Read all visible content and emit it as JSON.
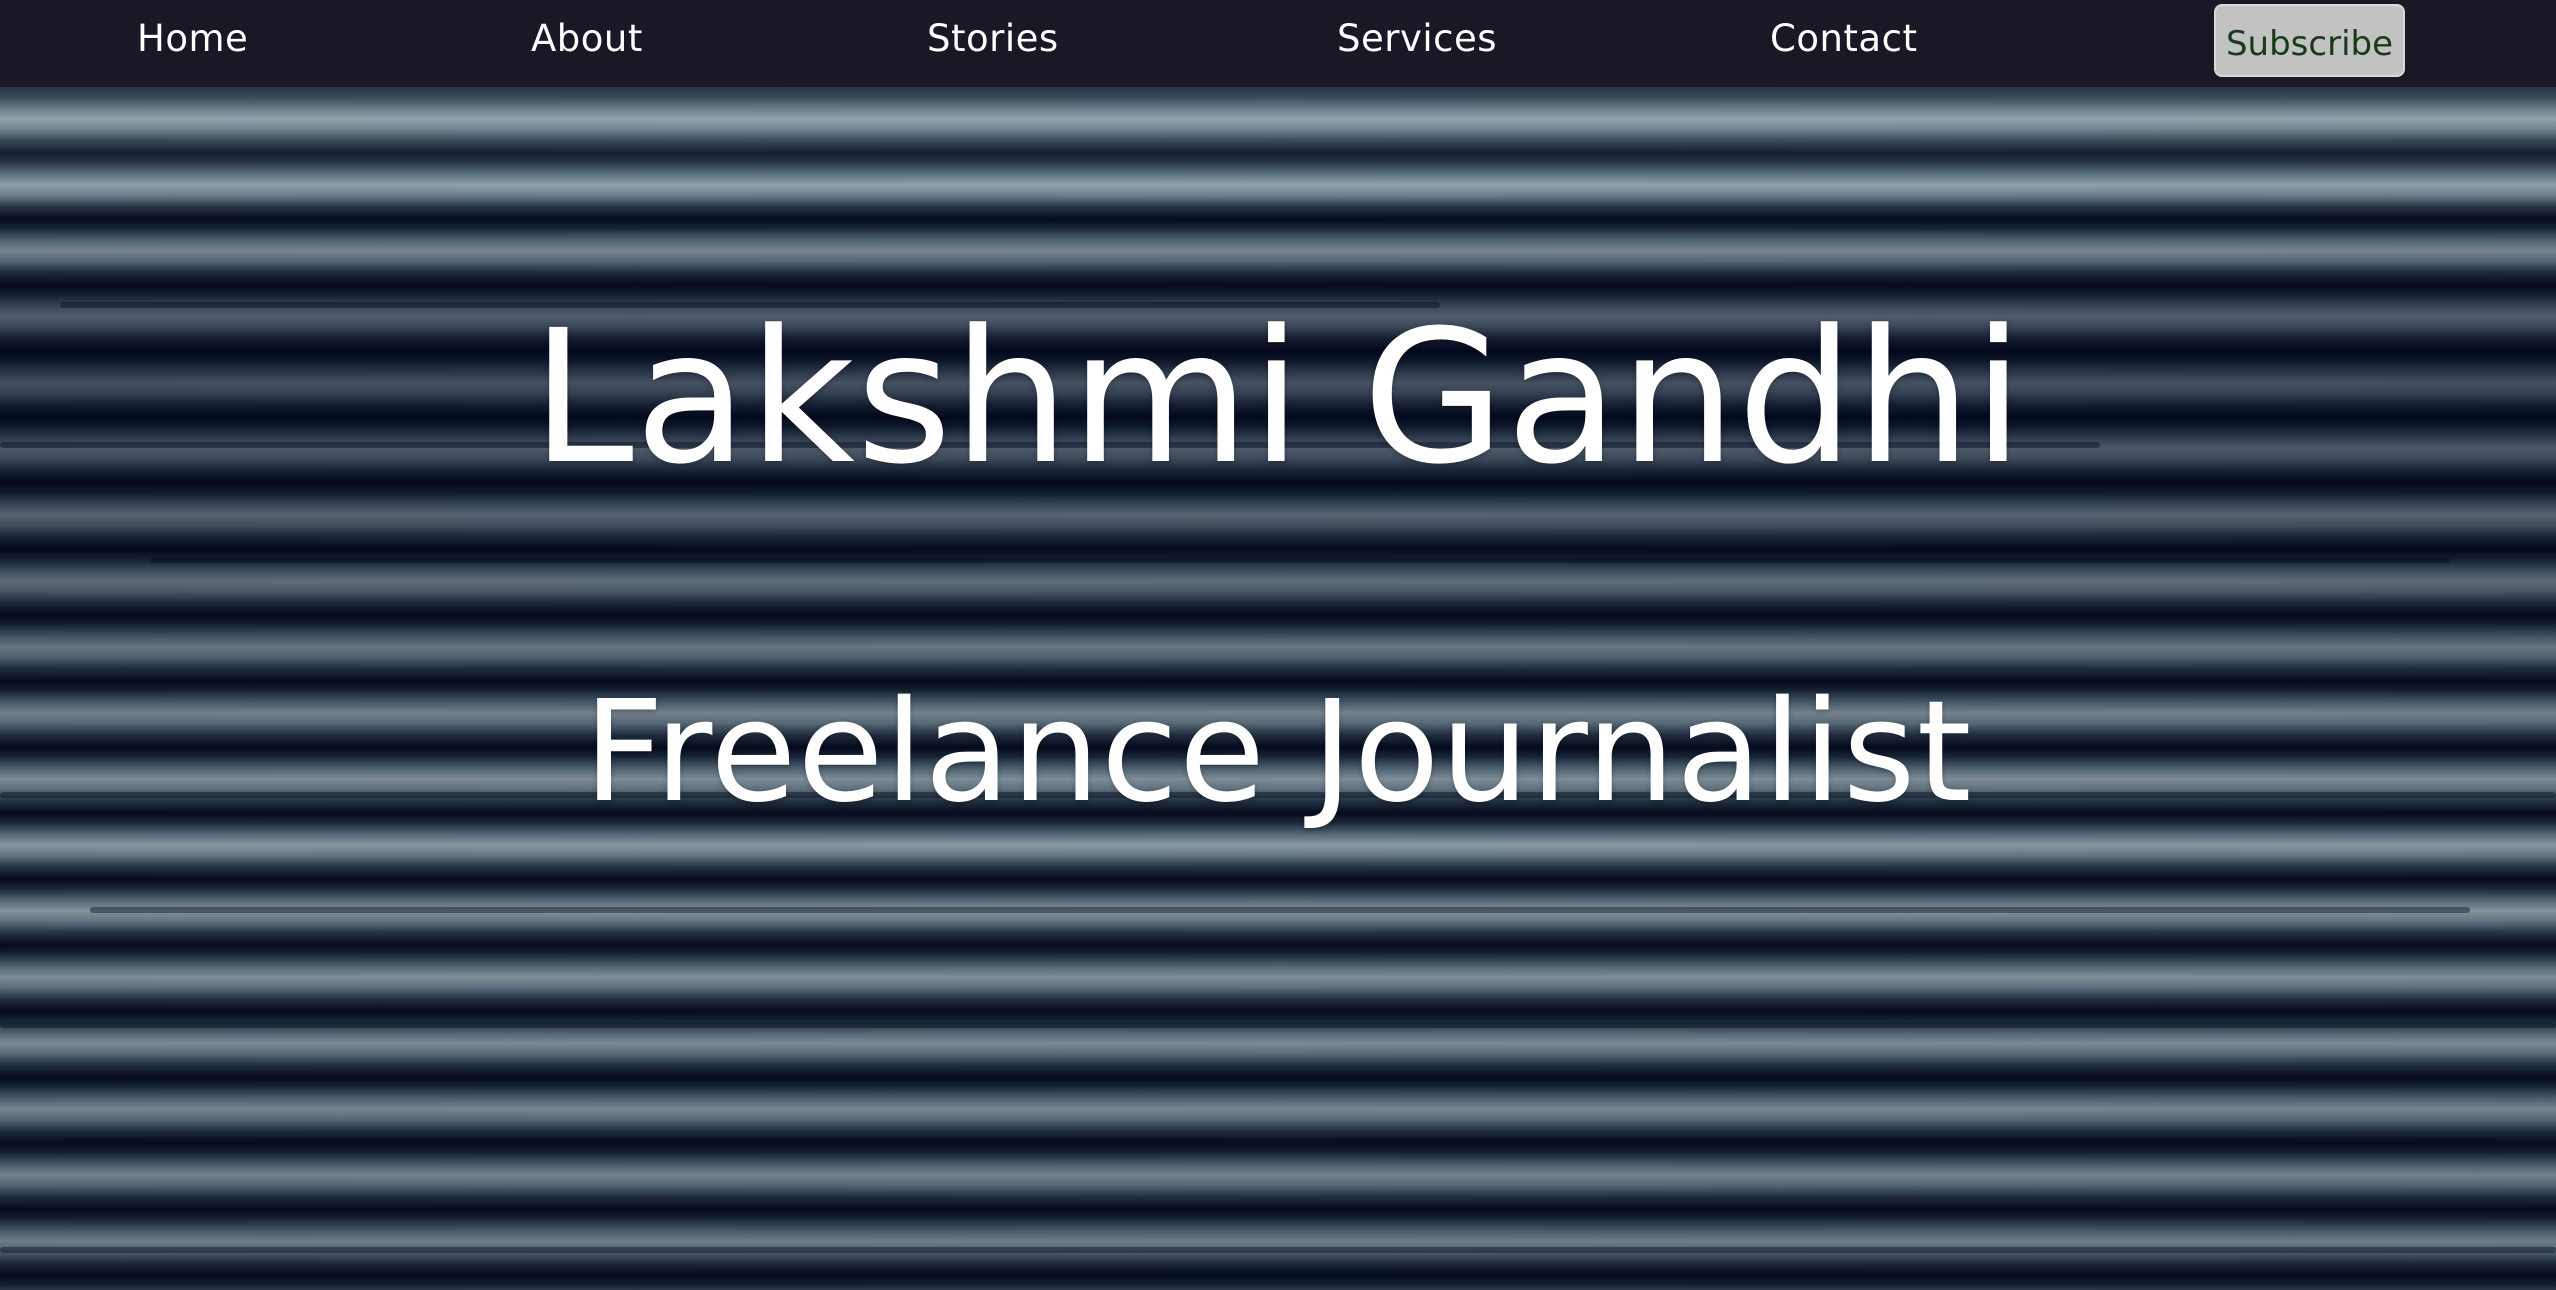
{
  "nav": {
    "items": [
      {
        "label": "Home"
      },
      {
        "label": "About"
      },
      {
        "label": "Stories"
      },
      {
        "label": "Services"
      },
      {
        "label": "Contact"
      }
    ],
    "subscribe_label": "Subscribe"
  },
  "hero": {
    "title": "Lakshmi Gandhi",
    "subtitle": "Freelance Journalist"
  },
  "colors": {
    "nav_background": "#1c1724",
    "nav_text": "#ffffff",
    "subscribe_background": "#c2c2c2",
    "subscribe_text": "#173b17",
    "hero_text": "#ffffff"
  }
}
